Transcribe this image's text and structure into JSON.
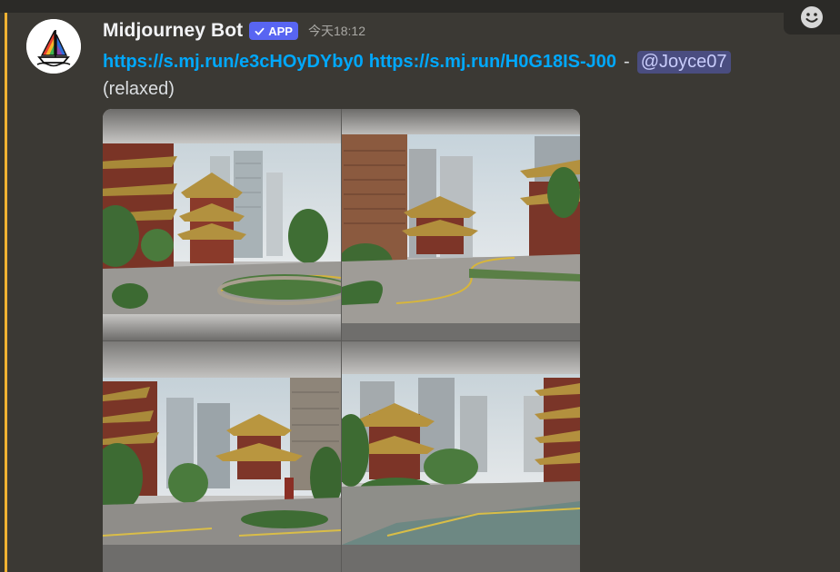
{
  "message": {
    "author": "Midjourney Bot",
    "badge": "APP",
    "timestamp": "今天18:12",
    "link1": "https://s.mj.run/e3cHOyDYby0",
    "link2": "https://s.mj.run/H0G18IS-J00",
    "separator": "-",
    "mention": "@Joyce07",
    "mode": "(relaxed)"
  },
  "image_grid": {
    "tiles": [
      "top-left",
      "top-right",
      "bottom-left",
      "bottom-right"
    ]
  },
  "icons": {
    "avatar": "midjourney-sailboat-logo",
    "badge_check": "checkmark-icon",
    "reaction": "smiley-face-icon"
  },
  "colors": {
    "accent_line": "#f0b232",
    "link": "#00a8fc",
    "badge": "#5865f2",
    "mention_bg": "#4a4d80"
  }
}
